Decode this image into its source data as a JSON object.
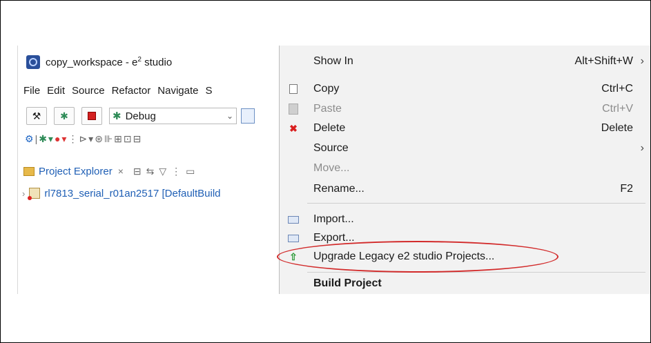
{
  "window": {
    "title_main": "copy_workspace - e",
    "title_sup": "2",
    "title_tail": " studio"
  },
  "menubar": [
    "File",
    "Edit",
    "Source",
    "Refactor",
    "Navigate",
    "S"
  ],
  "toolbar": {
    "launch_config": "Debug"
  },
  "project_explorer": {
    "tab_label": "Project Explorer",
    "project_label": "rl7813_serial_r01an2517 [DefaultBuild"
  },
  "context_menu": {
    "items": [
      {
        "label": "Show In",
        "shortcut": "Alt+Shift+W",
        "submenu": true,
        "enabled": true,
        "icon": "none"
      },
      {
        "label": "Copy",
        "shortcut": "Ctrl+C",
        "enabled": true,
        "icon": "copy-icon"
      },
      {
        "label": "Paste",
        "shortcut": "Ctrl+V",
        "enabled": false,
        "icon": "paste-icon"
      },
      {
        "label": "Delete",
        "shortcut": "Delete",
        "enabled": true,
        "icon": "delete-icon"
      },
      {
        "label": "Source",
        "submenu": true,
        "enabled": true,
        "icon": "none"
      },
      {
        "label": "Move...",
        "enabled": false,
        "icon": "none"
      },
      {
        "label": "Rename...",
        "shortcut": "F2",
        "enabled": true,
        "icon": "none"
      },
      {
        "label": "Import...",
        "enabled": true,
        "icon": "import-icon"
      },
      {
        "label": "Export...",
        "enabled": true,
        "icon": "export-icon"
      },
      {
        "label": "Upgrade Legacy e2 studio Projects...",
        "enabled": true,
        "icon": "upgrade-arrow-icon"
      },
      {
        "label": "Build Project",
        "enabled": true,
        "icon": "none"
      }
    ]
  },
  "colors": {
    "highlight_ellipse": "#d22a2a",
    "menu_bg": "#f2f2f2",
    "link_blue": "#1f5fb5"
  }
}
